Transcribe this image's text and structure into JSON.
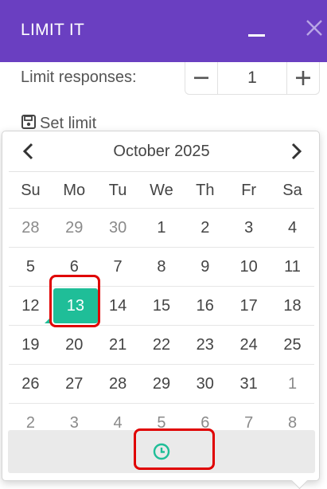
{
  "header": {
    "title": "LIMIT IT",
    "brand_color": "#6a3fc1"
  },
  "limit_responses": {
    "label": "Limit responses:",
    "value": "1",
    "minus_symbol": "−",
    "plus_symbol": "+"
  },
  "set_limit": {
    "label": "Set limit",
    "icon": "save-icon"
  },
  "calendar": {
    "month_label": "October 2025",
    "weekdays": [
      "Su",
      "Mo",
      "Tu",
      "We",
      "Th",
      "Fr",
      "Sa"
    ],
    "weeks": [
      [
        "28",
        "29",
        "30",
        "1",
        "2",
        "3",
        "4"
      ],
      [
        "5",
        "6",
        "7",
        "8",
        "9",
        "10",
        "11"
      ],
      [
        "12",
        "13",
        "14",
        "15",
        "16",
        "17",
        "18"
      ],
      [
        "19",
        "20",
        "21",
        "22",
        "23",
        "24",
        "25"
      ],
      [
        "26",
        "27",
        "28",
        "29",
        "30",
        "31",
        "1"
      ],
      [
        "2",
        "3",
        "4",
        "5",
        "6",
        "7",
        "8"
      ]
    ],
    "selected_day": "13",
    "today_day": "12",
    "accent_color": "#1fbe98",
    "time_toggle_icon": "clock-icon"
  },
  "annotation_color": "#e00000"
}
